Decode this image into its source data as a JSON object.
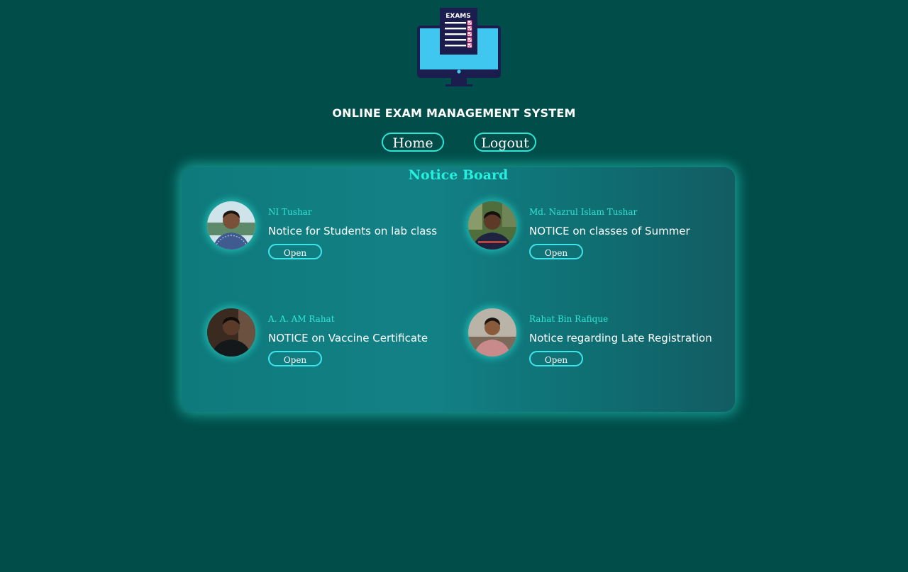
{
  "header": {
    "logo_text": "EXAMS",
    "app_title": "ONLINE EXAM MANAGEMENT SYSTEM"
  },
  "nav": {
    "home_label": "Home",
    "logout_label": "Logout"
  },
  "notice_board": {
    "title": "Notice Board",
    "notices": [
      {
        "author": "NI Tushar",
        "title": "Notice for Students on lab class",
        "button": "Open"
      },
      {
        "author": "Md. Nazrul Islam Tushar",
        "title": "NOTICE on classes of Summer",
        "button": "Open"
      },
      {
        "author": "A. A. AM Rahat",
        "title": "NOTICE on Vaccine Certificate",
        "button": "Open"
      },
      {
        "author": "Rahat Bin Rafique",
        "title": "Notice regarding Late Registration",
        "button": "Open"
      }
    ]
  },
  "colors": {
    "background": "#004d4a",
    "accent": "#2ee6d6",
    "board": "#128186",
    "text": "#ffffff"
  }
}
